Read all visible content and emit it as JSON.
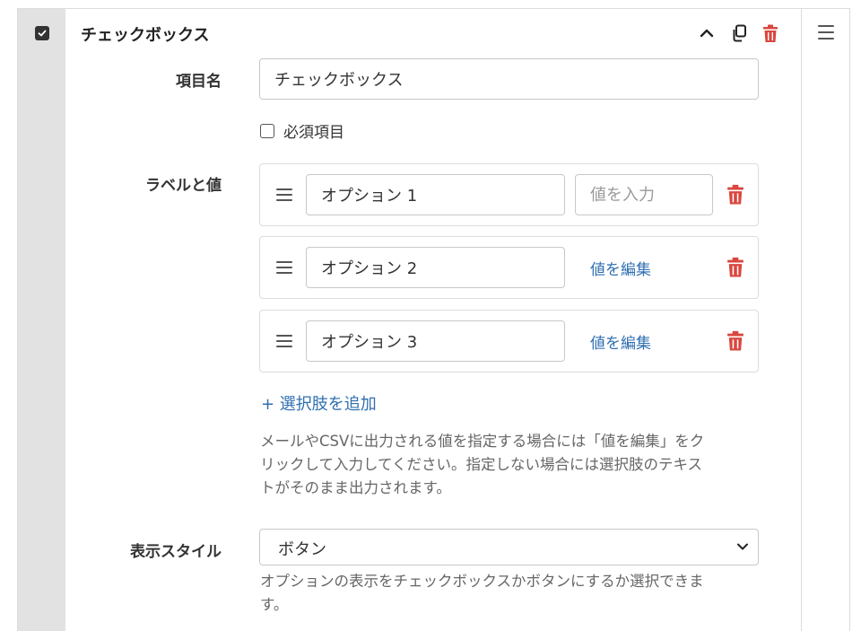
{
  "header": {
    "title": "チェックボックス"
  },
  "fields": {
    "item_name_label": "項目名",
    "item_name_value": "チェックボックス",
    "required_label": "必須項目",
    "labels_values_label": "ラベルと値",
    "display_style_label": "表示スタイル"
  },
  "options": [
    {
      "label": "オプション 1",
      "value_placeholder": "値を入力"
    },
    {
      "label": "オプション 2",
      "edit_label": "値を編集"
    },
    {
      "label": "オプション 3",
      "edit_label": "値を編集"
    }
  ],
  "add_option_label": "+ 選択肢を追加",
  "help_text_values_lines": [
    "メールやCSVに出力される値を指定する場合には「値を編集」をク",
    "リックして入力してください。指定しない場合には選択肢のテキス",
    "トがそのまま出力されます。"
  ],
  "display_style": {
    "selected": "ボタン",
    "help_lines": [
      "オプションの表示をチェックボックスかボタンにするか選択できま",
      "す。"
    ]
  },
  "colors": {
    "accent_link": "#2f6fb0",
    "danger": "#d9473f",
    "rail": "#e2e2e2"
  },
  "icons": {
    "collapse": "chevron-up-icon",
    "duplicate": "copy-icon",
    "delete": "trash-icon",
    "drag": "drag-handle-icon",
    "select": "chevron-down-icon"
  }
}
